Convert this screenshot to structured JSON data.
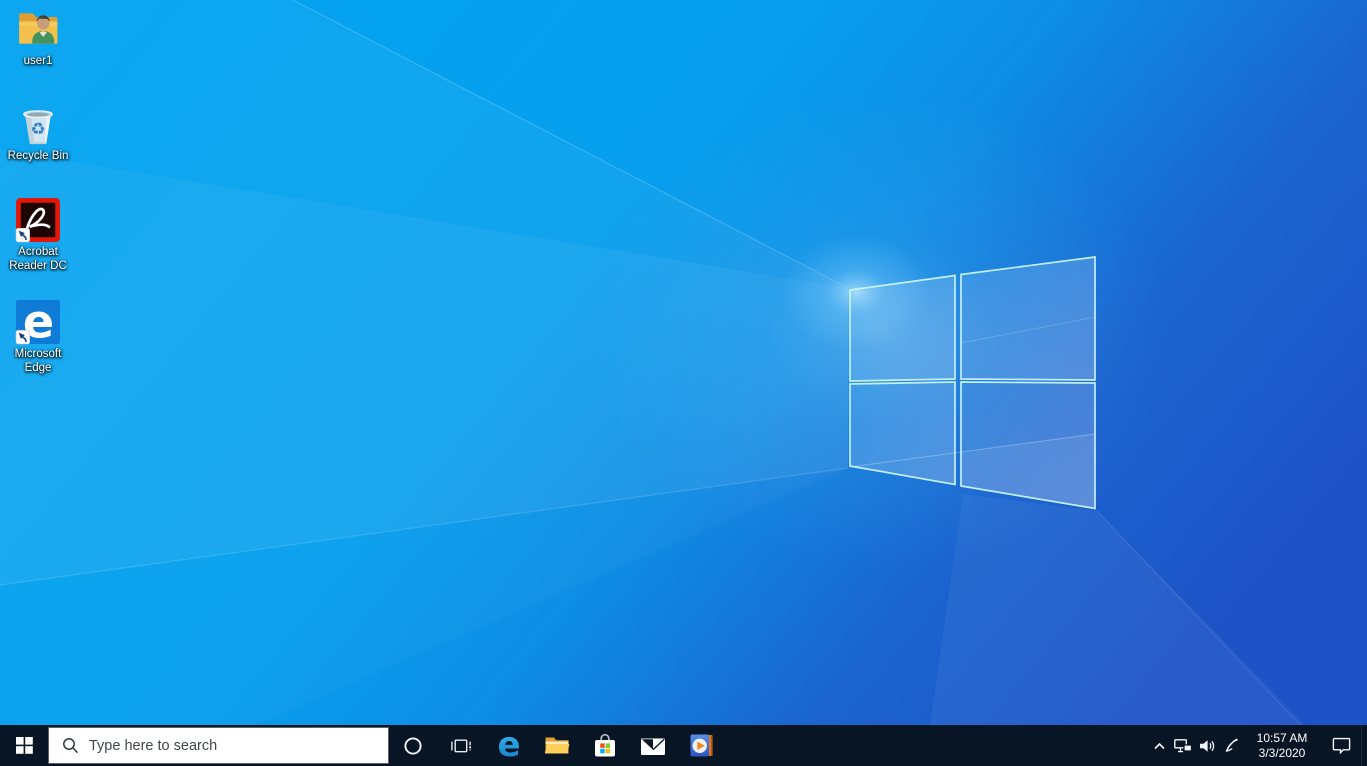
{
  "desktop": {
    "icons": [
      {
        "id": "user1",
        "icon": "user-folder-icon",
        "label": "user1"
      },
      {
        "id": "recycle-bin",
        "icon": "recycle-bin-icon",
        "label": "Recycle Bin"
      },
      {
        "id": "acrobat-reader",
        "icon": "acrobat-reader-icon",
        "label": "Acrobat Reader DC",
        "shortcut_overlay": true
      },
      {
        "id": "microsoft-edge",
        "icon": "edge-icon",
        "label": "Microsoft Edge",
        "shortcut_overlay": true
      }
    ]
  },
  "taskbar": {
    "start": {
      "icon": "windows-start-icon"
    },
    "search": {
      "placeholder": "Type here to search",
      "icon": "search-icon"
    },
    "apps": [
      {
        "id": "cortana",
        "icon": "cortana-circle-icon"
      },
      {
        "id": "task-view",
        "icon": "task-view-icon"
      },
      {
        "id": "edge",
        "icon": "edge-e-icon"
      },
      {
        "id": "file-explorer",
        "icon": "file-explorer-folder-icon"
      },
      {
        "id": "store",
        "icon": "microsoft-store-bag-icon"
      },
      {
        "id": "mail",
        "icon": "mail-envelope-icon"
      },
      {
        "id": "media-player",
        "icon": "windows-media-player-icon"
      }
    ],
    "tray": {
      "icons": [
        "chevron-up-icon",
        "network-icon",
        "volume-icon",
        "pen-ink-icon",
        "action-center-icon"
      ],
      "time": "10:57 AM",
      "date": "3/3/2020"
    }
  },
  "colors": {
    "taskbar_bg": "#081524",
    "wallpaper_left": "#02a3ef",
    "wallpaper_right": "#1d54c9",
    "logo_edge": "#c9f6f4",
    "accent_edge_blue": "#0f7bd7",
    "acrobat_red": "#e31708",
    "folder_yellow": "#f7c64a",
    "store_red": "#f1511b",
    "store_green": "#80cc28",
    "store_blue": "#00adef",
    "store_yellow": "#fbbc09"
  }
}
